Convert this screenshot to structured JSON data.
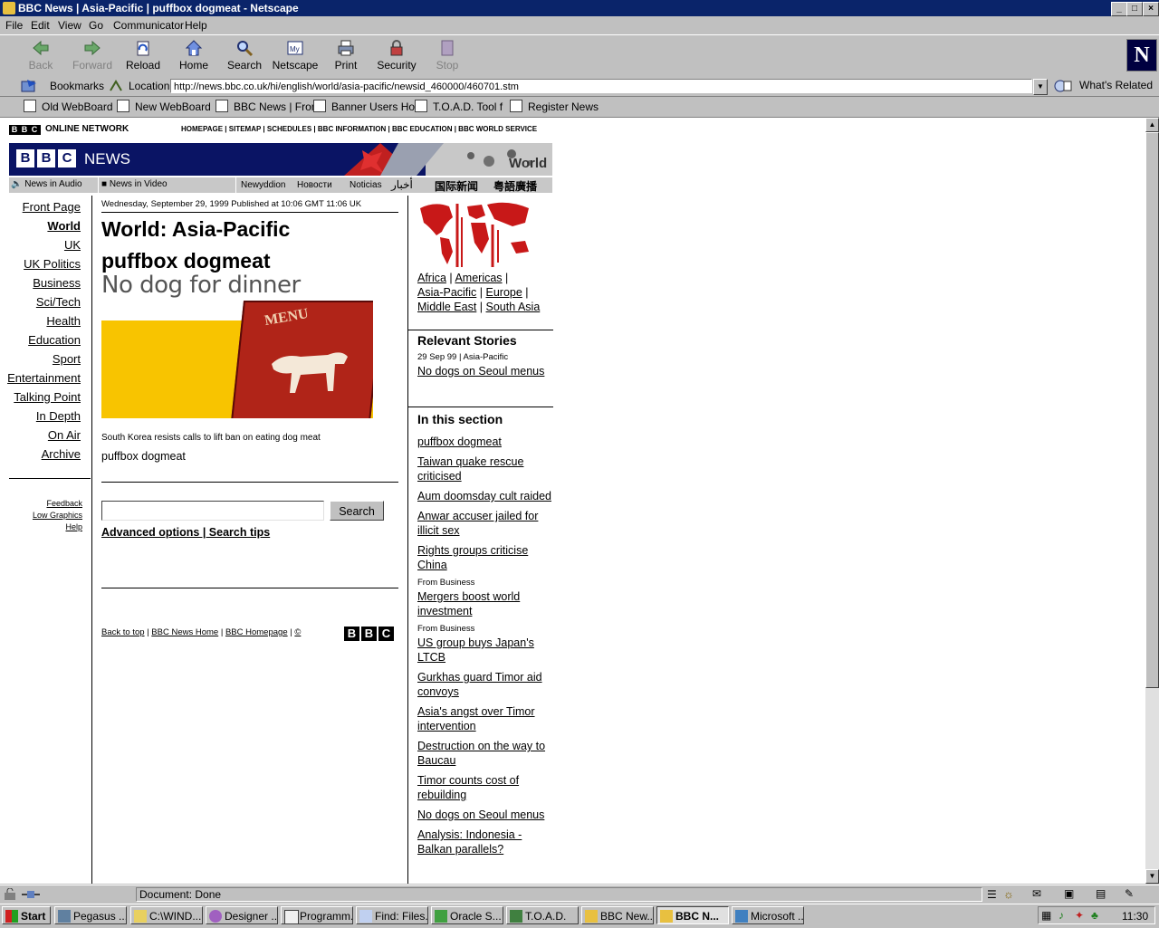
{
  "window": {
    "title": "BBC News | Asia-Pacific | puffbox dogmeat - Netscape"
  },
  "menu": [
    "File",
    "Edit",
    "View",
    "Go",
    "Communicator",
    "Help"
  ],
  "toolbar": [
    {
      "label": "Back",
      "icon": "back-arrow-icon",
      "enabled": false
    },
    {
      "label": "Forward",
      "icon": "forward-arrow-icon",
      "enabled": false
    },
    {
      "label": "Reload",
      "icon": "reload-icon",
      "enabled": true
    },
    {
      "label": "Home",
      "icon": "home-icon",
      "enabled": true
    },
    {
      "label": "Search",
      "icon": "search-icon",
      "enabled": true
    },
    {
      "label": "Netscape",
      "icon": "my-netscape-icon",
      "enabled": true
    },
    {
      "label": "Print",
      "icon": "print-icon",
      "enabled": true
    },
    {
      "label": "Security",
      "icon": "security-lock-icon",
      "enabled": true
    },
    {
      "label": "Stop",
      "icon": "stop-icon",
      "enabled": false
    }
  ],
  "logo": "N",
  "location": {
    "bookmarks_label": "Bookmarks",
    "location_label": "Location:",
    "url": "http://news.bbc.co.uk/hi/english/world/asia-pacific/newsid_460000/460701.stm",
    "whats_related": "What's Related"
  },
  "personal_bar": [
    "Old WebBoard",
    "New WebBoard",
    "BBC News | Fron",
    "Banner Users Ho",
    "T.O.A.D. Tool f",
    "Register News"
  ],
  "page": {
    "network": "ONLINE NETWORK",
    "top_links": "HOMEPAGE | SITEMAP | SCHEDULES | BBC INFORMATION | BBC EDUCATION | BBC WORLD SERVICE",
    "bbc_logo": "B B C",
    "news_label": "NEWS",
    "world_label": "World",
    "lang_bar": [
      "News in Audio",
      "News in Video",
      "Newyddion",
      "Новости",
      "Noticias",
      "أخبار",
      "国际新闻",
      "粤語廣播"
    ],
    "nav": [
      "Front Page",
      "World",
      "UK",
      "UK Politics",
      "Business",
      "Sci/Tech",
      "Health",
      "Education",
      "Sport",
      "Entertainment",
      "Talking Point",
      "In Depth",
      "On Air",
      "Archive"
    ],
    "nav_small": [
      "Feedback",
      "Low Graphics",
      "Help"
    ],
    "dateline": "Wednesday, September 29, 1999 Published at 10:06 GMT 11:06 UK",
    "section_title": "World: Asia-Pacific",
    "headline": "puffbox dogmeat",
    "image_caption_title": "No dog for dinner",
    "menu_word": "MENU",
    "caption": "South Korea resists calls to lift ban on eating dog meat",
    "body": "puffbox dogmeat",
    "search_button": "Search",
    "advanced": "Advanced options | Search tips",
    "footer_links": [
      "Back to top",
      "BBC News Home",
      "BBC Homepage",
      "©"
    ],
    "regions": [
      "Africa",
      "Americas",
      "Asia-Pacific",
      "Europe",
      "Middle East",
      "South Asia"
    ],
    "relevant_title": "Relevant Stories",
    "relevant_meta": "29 Sep 99 | Asia-Pacific",
    "relevant_link": "No dogs on Seoul menus",
    "insection_title": "In this section",
    "insection": [
      {
        "pre": "",
        "text": "puffbox dogmeat"
      },
      {
        "pre": "",
        "text": "Taiwan quake rescue criticised"
      },
      {
        "pre": "",
        "text": "Aum doomsday cult raided"
      },
      {
        "pre": "",
        "text": "Anwar accuser jailed for illicit sex"
      },
      {
        "pre": "",
        "text": "Rights groups criticise China"
      },
      {
        "pre": "From Business",
        "text": "Mergers boost world investment"
      },
      {
        "pre": "From Business",
        "text": "US group buys Japan's LTCB"
      },
      {
        "pre": "",
        "text": "Gurkhas guard Timor aid convoys"
      },
      {
        "pre": "",
        "text": "Asia's angst over Timor intervention"
      },
      {
        "pre": "",
        "text": "Destruction on the way to Baucau"
      },
      {
        "pre": "",
        "text": "Timor counts cost of rebuilding"
      },
      {
        "pre": "",
        "text": "No dogs on Seoul menus"
      },
      {
        "pre": "",
        "text": "Analysis: Indonesia - Balkan parallels?"
      }
    ]
  },
  "status": {
    "text": "Document: Done"
  },
  "taskbar": {
    "start": "Start",
    "tasks": [
      "Pegasus ...",
      "C:\\WIND...",
      "Designer ...",
      "Programm...",
      "Find: Files...",
      "Oracle S...",
      "T.O.A.D.",
      "BBC New...",
      "BBC N...",
      "Microsoft ..."
    ],
    "active_index": 8,
    "clock": "11:30"
  }
}
